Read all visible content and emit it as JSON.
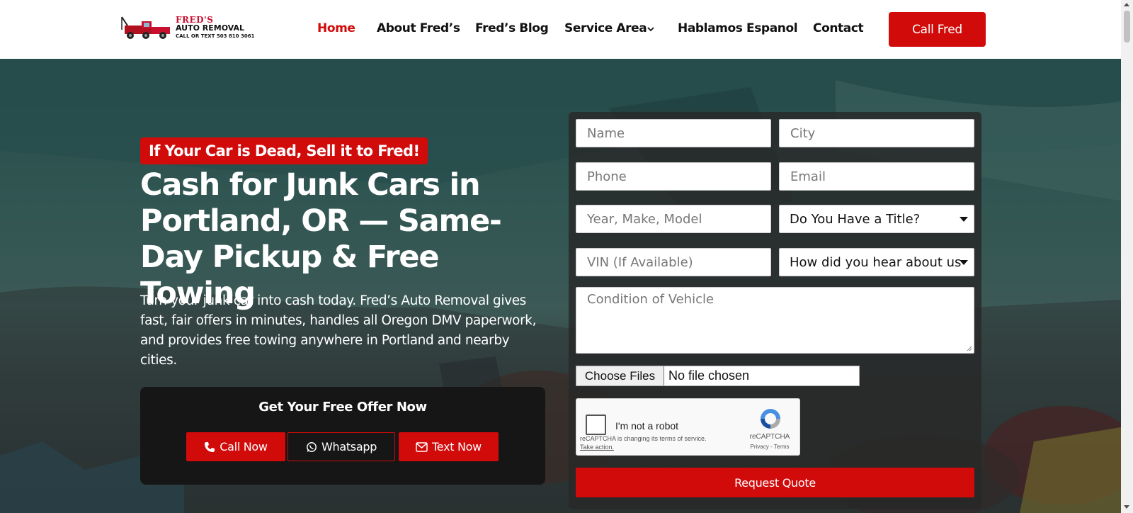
{
  "logo": {
    "line1": "FRED'S",
    "line2": "AUTO REMOVAL",
    "line3": "CALL OR TEXT 503 810 3061"
  },
  "nav": {
    "items": [
      {
        "label": "Home",
        "active": true
      },
      {
        "label": "About Fred’s"
      },
      {
        "label": "Fred’s Blog"
      },
      {
        "label": "Service Area",
        "dropdown": true
      },
      {
        "label": "Hablamos Espanol"
      },
      {
        "label": "Contact"
      }
    ],
    "cta": "Call Fred"
  },
  "hero": {
    "tagline": "If Your Car is Dead, Sell it to Fred!",
    "headline": "Cash for Junk Cars in Portland, OR — Same-Day Pickup & Free Towing",
    "lead": "Turn your junk car into cash today. Fred’s Auto Removal gives fast, fair offers in minutes, handles all Oregon DMV paperwork, and provides free towing anywhere in Portland and nearby cities.",
    "offer_title": "Get Your Free Offer Now",
    "buttons": {
      "call": "Call Now",
      "whatsapp": "Whatsapp",
      "text": "Text Now"
    }
  },
  "form": {
    "name_placeholder": "Name",
    "city_placeholder": "City",
    "phone_placeholder": "Phone",
    "email_placeholder": "Email",
    "vehicle_placeholder": "Year, Make, Model",
    "title_select": "Do You Have a Title?",
    "vin_placeholder": "VIN (If Available)",
    "heard_select": "How did you hear about us",
    "condition_placeholder": "Condition of Vehicle",
    "file_button": "Choose Files",
    "file_status": "No file chosen",
    "captcha": {
      "label": "I'm not a robot",
      "note": "reCAPTCHA is changing its terms of service.",
      "take_action": "Take action.",
      "brand": "reCAPTCHA",
      "terms": "Privacy - Terms"
    },
    "submit": "Request Quote"
  },
  "colors": {
    "brand_red": "#d10a0a",
    "dark_panel": "#161616"
  }
}
